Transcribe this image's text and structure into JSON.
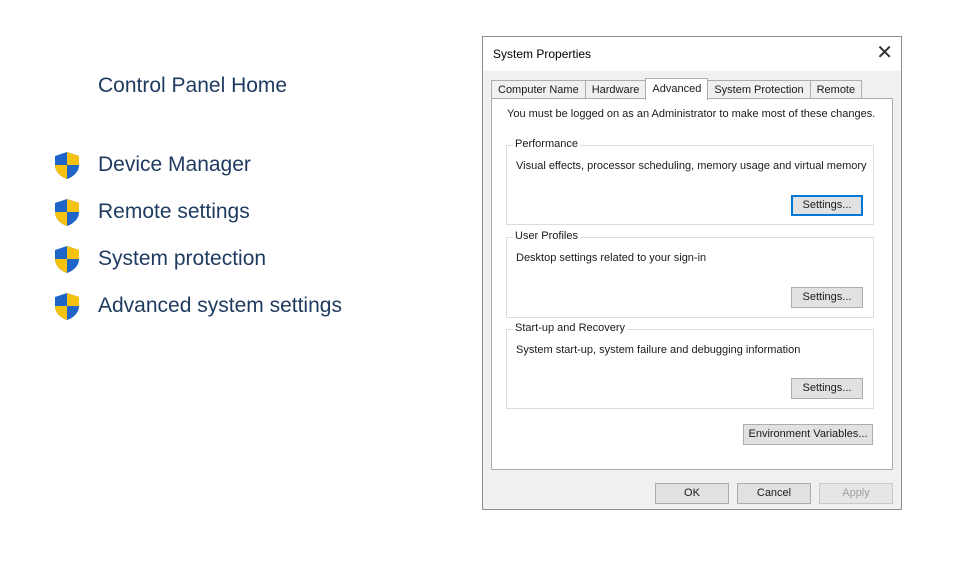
{
  "control_panel": {
    "home": "Control Panel Home",
    "links": [
      {
        "label": "Device Manager",
        "icon": "uac-shield-icon"
      },
      {
        "label": "Remote settings",
        "icon": "uac-shield-icon"
      },
      {
        "label": "System protection",
        "icon": "uac-shield-icon"
      },
      {
        "label": "Advanced system settings",
        "icon": "uac-shield-icon"
      }
    ]
  },
  "dialog": {
    "title": "System Properties",
    "close_glyph": "✕",
    "tabs": [
      "Computer Name",
      "Hardware",
      "Advanced",
      "System Protection",
      "Remote"
    ],
    "active_tab": "Advanced",
    "admin_note": "You must be logged on as an Administrator to make most of these changes.",
    "groups": [
      {
        "legend": "Performance",
        "description": "Visual effects, processor scheduling, memory usage and virtual memory",
        "button": "Settings..."
      },
      {
        "legend": "User Profiles",
        "description": "Desktop settings related to your sign-in",
        "button": "Settings..."
      },
      {
        "legend": "Start-up and Recovery",
        "description": "System start-up, system failure and debugging information",
        "button": "Settings..."
      }
    ],
    "env_button": "Environment Variables...",
    "ok": "OK",
    "cancel": "Cancel",
    "apply": "Apply"
  },
  "colors": {
    "link_text": "#1e3a5f",
    "shield_blue": "#1f64c8",
    "shield_yellow": "#f5c211",
    "focus_blue": "#0078d7"
  }
}
